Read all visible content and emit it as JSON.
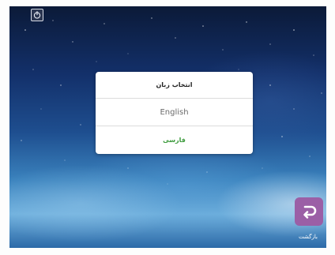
{
  "dialog": {
    "title": "انتخاب زبان",
    "options": [
      "English",
      "فارسی"
    ],
    "selected_color": "#3b9a3b"
  },
  "bottom": {
    "back_label": "بازگشت"
  },
  "icons": {
    "top_left": "home-icon",
    "back": "return-arrow-icon"
  },
  "colors": {
    "accent": "#9b5fa6",
    "dialog_bg": "#ffffff"
  }
}
